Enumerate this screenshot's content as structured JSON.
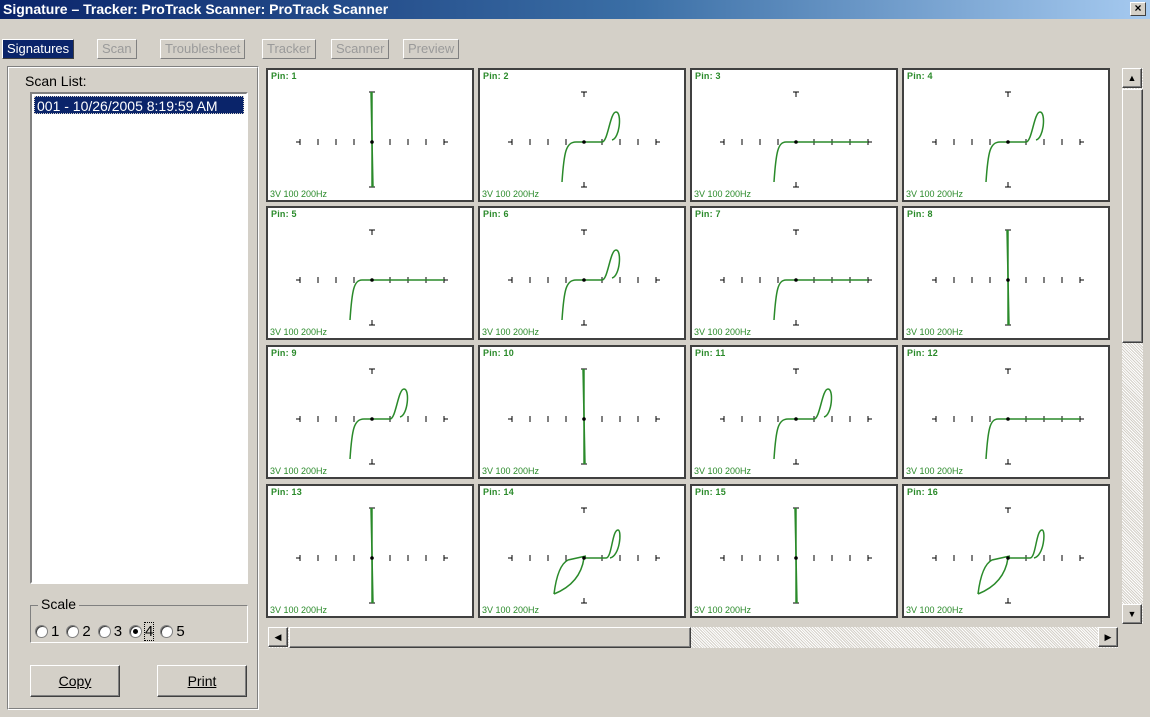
{
  "window": {
    "title": "Signature – Tracker: ProTrack  Scanner: ProTrack Scanner",
    "close_label": "×"
  },
  "tabs": [
    {
      "label": "Signatures",
      "active": true
    },
    {
      "label": "Scan",
      "active": false
    },
    {
      "label": "Troublesheet",
      "active": false
    },
    {
      "label": "Tracker",
      "active": false
    },
    {
      "label": "Scanner",
      "active": false
    },
    {
      "label": "Preview",
      "active": false
    }
  ],
  "scan_list": {
    "label": "Scan List:",
    "items": [
      "001 - 10/26/2005 8:19:59 AM"
    ],
    "selected_index": 0
  },
  "scale": {
    "legend": "Scale",
    "options": [
      "1",
      "2",
      "3",
      "4",
      "5"
    ],
    "selected": "4"
  },
  "buttons": {
    "copy": "Copy",
    "print": "Print"
  },
  "accent": "#0a246a",
  "trace_color": "#2a8a2a",
  "signatures": [
    {
      "pin": "Pin: 1",
      "conditions": "3V 100 200Hz",
      "curve": "short"
    },
    {
      "pin": "Pin: 2",
      "conditions": "3V 100 200Hz",
      "curve": "diode-loop"
    },
    {
      "pin": "Pin: 3",
      "conditions": "3V 100 200Hz",
      "curve": "diode"
    },
    {
      "pin": "Pin: 4",
      "conditions": "3V 100 200Hz",
      "curve": "diode-loop"
    },
    {
      "pin": "Pin: 5",
      "conditions": "3V 100 200Hz",
      "curve": "diode"
    },
    {
      "pin": "Pin: 6",
      "conditions": "3V 100 200Hz",
      "curve": "diode-loop"
    },
    {
      "pin": "Pin: 7",
      "conditions": "3V 100 200Hz",
      "curve": "diode"
    },
    {
      "pin": "Pin: 8",
      "conditions": "3V 100 200Hz",
      "curve": "short"
    },
    {
      "pin": "Pin: 9",
      "conditions": "3V 100 200Hz",
      "curve": "diode-loop"
    },
    {
      "pin": "Pin: 10",
      "conditions": "3V 100 200Hz",
      "curve": "short"
    },
    {
      "pin": "Pin: 11",
      "conditions": "3V 100 200Hz",
      "curve": "diode-loop"
    },
    {
      "pin": "Pin: 12",
      "conditions": "3V 100 200Hz",
      "curve": "diode"
    },
    {
      "pin": "Pin: 13",
      "conditions": "3V 100 200Hz",
      "curve": "short"
    },
    {
      "pin": "Pin: 14",
      "conditions": "3V 100 200Hz",
      "curve": "cap-loop"
    },
    {
      "pin": "Pin: 15",
      "conditions": "3V 100 200Hz",
      "curve": "short"
    },
    {
      "pin": "Pin: 16",
      "conditions": "3V 100 200Hz",
      "curve": "cap-loop"
    }
  ]
}
